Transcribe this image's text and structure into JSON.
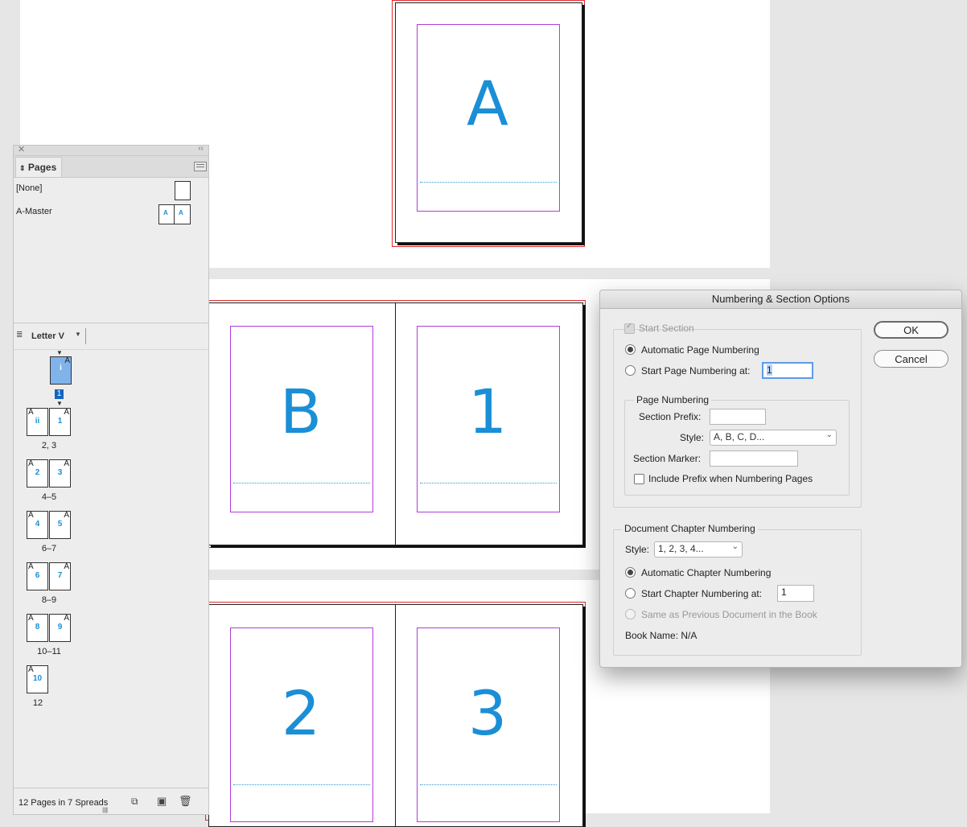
{
  "spreads": [
    {
      "letters": [
        "A"
      ]
    },
    {
      "letters": [
        "B",
        "1"
      ]
    },
    {
      "letters": [
        "2",
        "3"
      ]
    }
  ],
  "pages_panel": {
    "tab_label": "Pages",
    "masters": [
      {
        "label": "[None]"
      },
      {
        "label": "A-Master",
        "thumb_letters": [
          "A",
          "A"
        ]
      }
    ],
    "size_label": "Letter V",
    "page_items": [
      {
        "label": "1",
        "pages": [
          {
            "master": "A",
            "num": "i"
          }
        ]
      },
      {
        "label": "2, 3",
        "pages": [
          {
            "master": "A",
            "num": "ii"
          },
          {
            "master": "A",
            "num": "1"
          }
        ]
      },
      {
        "label": "4–5",
        "pages": [
          {
            "master": "A",
            "num": "2"
          },
          {
            "master": "A",
            "num": "3"
          }
        ]
      },
      {
        "label": "6–7",
        "pages": [
          {
            "master": "A",
            "num": "4"
          },
          {
            "master": "A",
            "num": "5"
          }
        ]
      },
      {
        "label": "8–9",
        "pages": [
          {
            "master": "A",
            "num": "6"
          },
          {
            "master": "A",
            "num": "7"
          }
        ]
      },
      {
        "label": "10–11",
        "pages": [
          {
            "master": "A",
            "num": "8"
          },
          {
            "master": "A",
            "num": "9"
          }
        ]
      },
      {
        "label": "12",
        "pages": [
          {
            "master": "A",
            "num": "10"
          }
        ]
      }
    ],
    "status": "12 Pages in 7 Spreads"
  },
  "dialog": {
    "title": "Numbering & Section Options",
    "start_section": "Start Section",
    "auto_numbering": "Automatic Page Numbering",
    "start_numbering_at": "Start Page Numbering at:",
    "start_numbering_value": "1",
    "page_numbering_legend": "Page Numbering",
    "section_prefix_label": "Section Prefix:",
    "section_prefix_value": "",
    "style_label": "Style:",
    "style_value": "A, B, C, D...",
    "section_marker_label": "Section Marker:",
    "section_marker_value": "",
    "include_prefix": "Include Prefix when Numbering Pages",
    "chapter_legend": "Document Chapter Numbering",
    "chapter_style_label": "Style:",
    "chapter_style_value": "1, 2, 3, 4...",
    "auto_chapter": "Automatic Chapter Numbering",
    "start_chapter_at": "Start Chapter Numbering at:",
    "start_chapter_value": "1",
    "same_as_previous": "Same as Previous Document in the Book",
    "book_name": "Book Name: N/A",
    "ok": "OK",
    "cancel": "Cancel"
  }
}
